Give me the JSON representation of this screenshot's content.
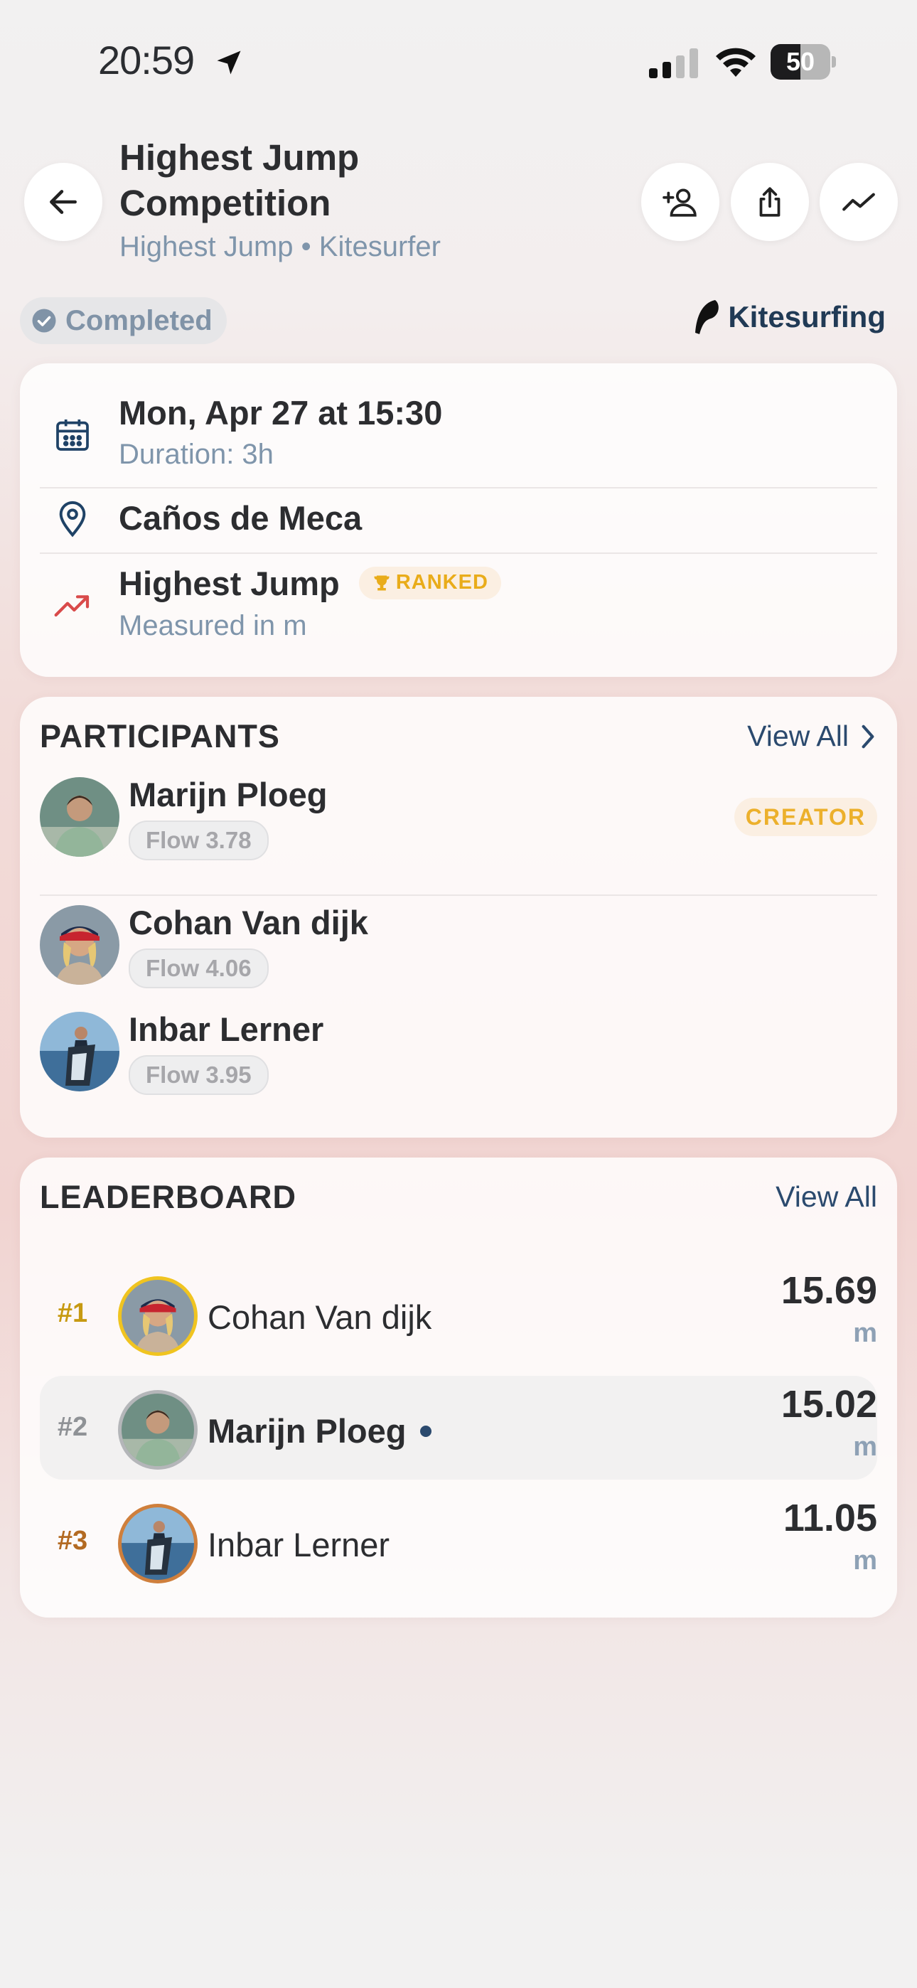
{
  "status_bar": {
    "time": "20:59",
    "battery": "50",
    "battery_level": 0.5,
    "icons": [
      "location-arrow-icon",
      "signal-icon",
      "wifi-icon",
      "battery-icon"
    ]
  },
  "header": {
    "title": "Highest Jump Competition",
    "subtitle": "Highest Jump • Kitesurfer",
    "icons": [
      "back-arrow-icon",
      "add-person-icon",
      "share-icon",
      "trend-icon"
    ]
  },
  "status_pill": "Completed",
  "sport": "Kitesurfing",
  "info": {
    "date": "Mon, Apr 27 at 15:30",
    "duration": "Duration: 3h",
    "location": "Caños de Meca",
    "metric": "Highest Jump",
    "ranked_label": "RANKED",
    "measured": "Measured in m"
  },
  "participants": {
    "title": "PARTICIPANTS",
    "view_all": "View All",
    "creator_label": "CREATOR",
    "items": [
      {
        "name": "Marijn Ploeg",
        "flow": "Flow 3.78"
      },
      {
        "name": "Cohan Van dijk",
        "flow": "Flow 4.06"
      },
      {
        "name": "Inbar Lerner",
        "flow": "Flow 3.95"
      }
    ]
  },
  "leaderboard": {
    "title": "LEADERBOARD",
    "view_all": "View All",
    "entries": [
      {
        "rank": "#1",
        "name": "Cohan Van dijk",
        "score": "15.69",
        "unit": "m"
      },
      {
        "rank": "#2",
        "name": "Marijn Ploeg",
        "score": "15.02",
        "unit": "m"
      },
      {
        "rank": "#3",
        "name": "Inbar Lerner",
        "score": "11.05",
        "unit": "m"
      }
    ]
  },
  "colors": {
    "gold": "#c79a12",
    "silver": "#8f9296",
    "bronze": "#b36a22",
    "accent_blue": "#2b4a6e",
    "trend_red": "#d94a4a"
  }
}
